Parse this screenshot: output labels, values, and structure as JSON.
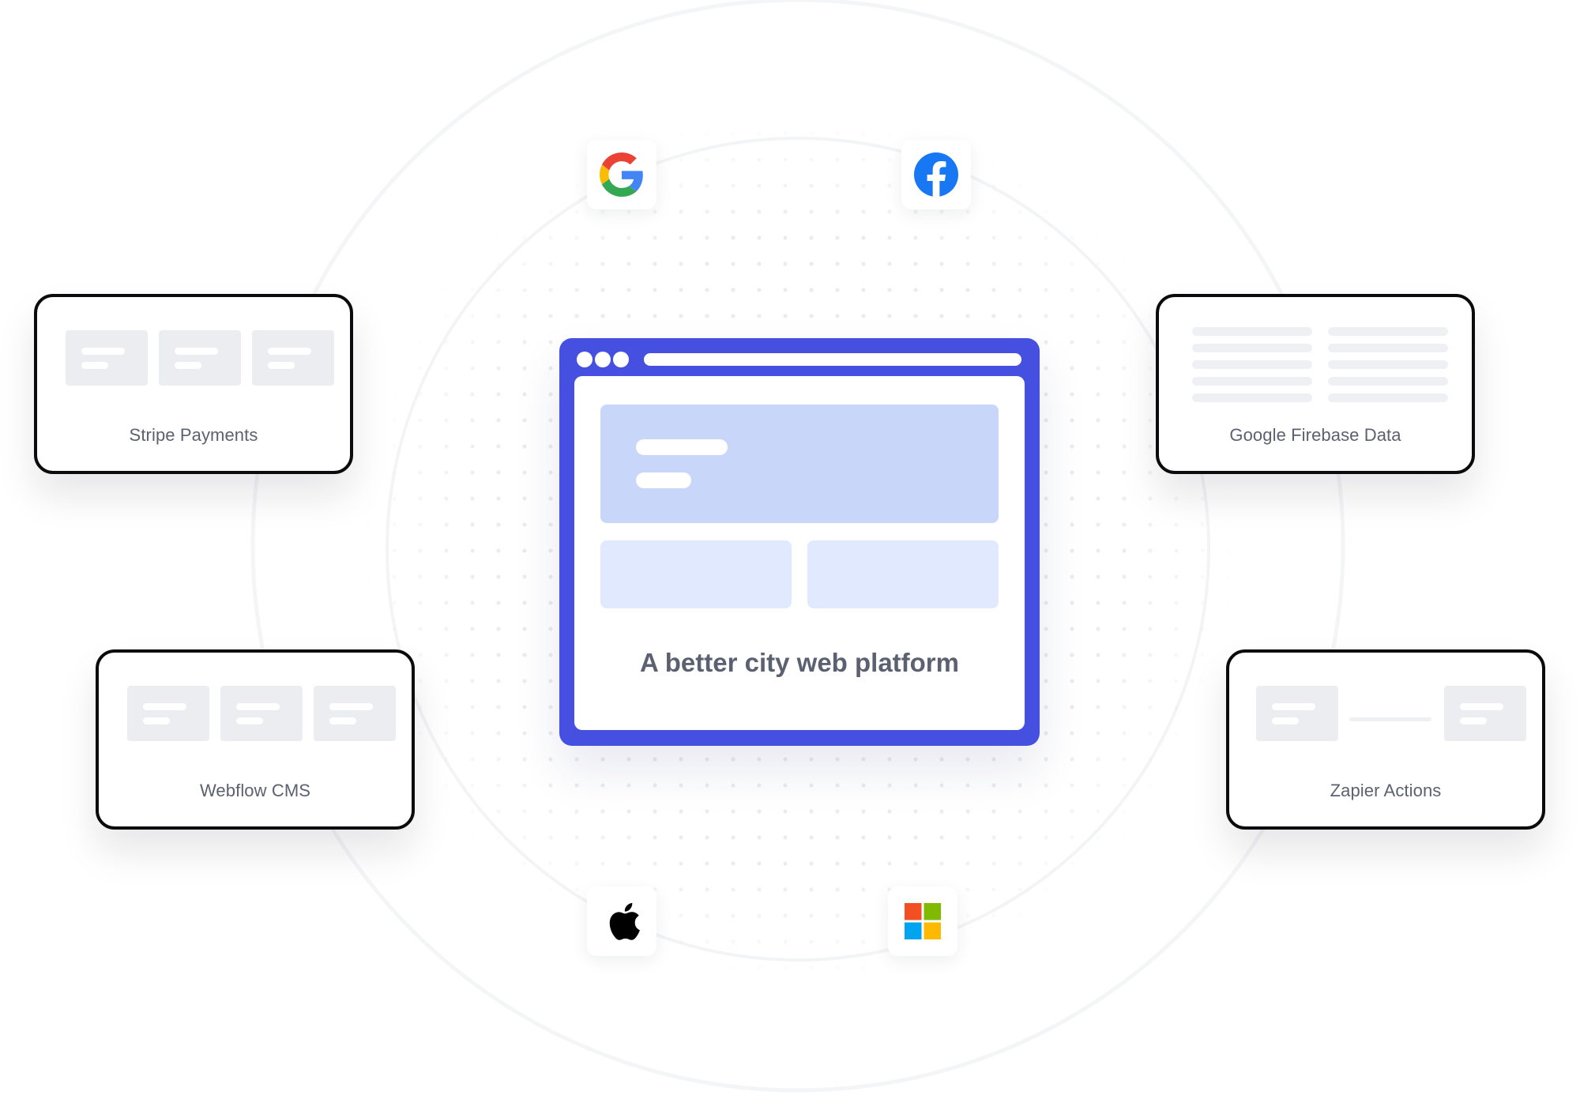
{
  "main": {
    "headline": "A better city web platform"
  },
  "integrations": [
    {
      "label": "Stripe Payments"
    },
    {
      "label": "Google Firebase Data"
    },
    {
      "label": "Webflow CMS"
    },
    {
      "label": "Zapier Actions"
    }
  ],
  "logos": [
    {
      "icon": "google-icon"
    },
    {
      "icon": "facebook-icon"
    },
    {
      "icon": "apple-icon"
    },
    {
      "icon": "microsoft-icon"
    }
  ],
  "colors": {
    "browser": "#4650e0",
    "hero": "#c8d6fa",
    "block": "#e0e9fd",
    "text": "#5b6170",
    "google_blue": "#4285f4",
    "google_red": "#ea4335",
    "google_yellow": "#fbbc05",
    "google_green": "#34a853",
    "facebook_blue": "#1877f2",
    "ms_red": "#f25022",
    "ms_green": "#7fba00",
    "ms_blue": "#00a4ef",
    "ms_yellow": "#ffb900"
  }
}
